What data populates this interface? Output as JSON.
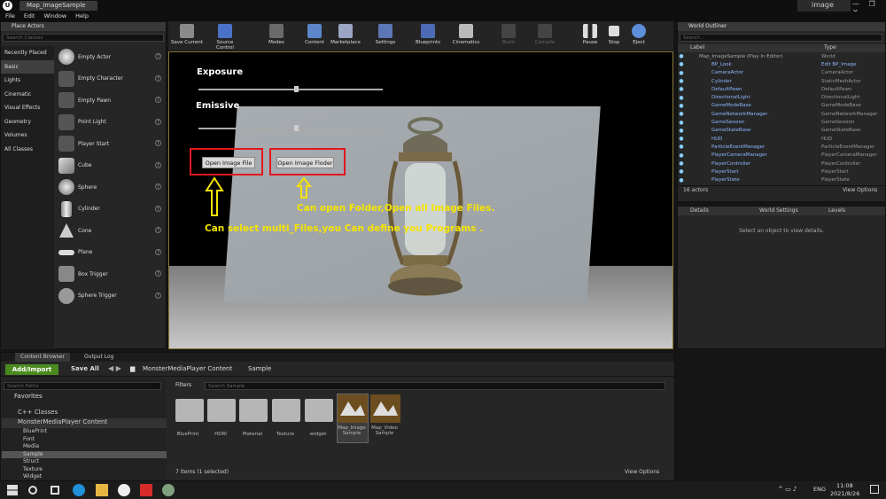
{
  "window": {
    "tab": "Map_ImageSample",
    "project": "image",
    "controls": "— ❐ ✕"
  },
  "menu": [
    "File",
    "Edit",
    "Window",
    "Help"
  ],
  "place_actors": {
    "tab": "Place Actors",
    "search_placeholder": "Search Classes",
    "categories": [
      "Recently Placed",
      "Basic",
      "Lights",
      "Cinematic",
      "Visual Effects",
      "Geometry",
      "Volumes",
      "All Classes"
    ],
    "selected": "Basic",
    "actors": [
      "Empty Actor",
      "Empty Character",
      "Empty Pawn",
      "Point Light",
      "Player Start",
      "Cube",
      "Sphere",
      "Cylinder",
      "Cone",
      "Plane",
      "Box Trigger",
      "Sphere Trigger"
    ],
    "help": "?"
  },
  "toolbar": [
    {
      "label": "Save Current"
    },
    {
      "label": "Source Control"
    },
    {
      "label": "Modes"
    },
    {
      "label": "Content"
    },
    {
      "label": "Marketplace"
    },
    {
      "label": "Settings"
    },
    {
      "label": "Blueprints"
    },
    {
      "label": "Cinematics"
    },
    {
      "label": "Build"
    },
    {
      "label": "Compile"
    },
    {
      "label": "Pause"
    },
    {
      "label": "Stop"
    },
    {
      "label": "Eject"
    }
  ],
  "viewport": {
    "exposure": "Exposure",
    "emissive": "Emissive",
    "exposure_level": 0.52,
    "emissive_level": 0.52,
    "open_file": "Open Image File",
    "open_folder": "Open Image Floder",
    "note_folder": "Can open Folder,Open all Image Files.",
    "note_files": "Can select multi_Files,you Can define you Programs ."
  },
  "outliner": {
    "tab": "World Outliner",
    "search_placeholder": "Search...",
    "col_label": "Label",
    "col_type": "Type",
    "rows": [
      [
        "Map_ImageSample (Play In Editor)",
        "World"
      ],
      [
        "BP_Look",
        "Edit BP_Image"
      ],
      [
        "CameraActor",
        "CameraActor"
      ],
      [
        "Cylinder",
        "StaticMeshActor"
      ],
      [
        "DefaultPawn",
        "DefaultPawn"
      ],
      [
        "DirectionalLight",
        "DirectionalLight"
      ],
      [
        "GameModeBase",
        "GameModeBase"
      ],
      [
        "GameNetworkManager",
        "GameNetworkManager"
      ],
      [
        "GameSession",
        "GameSession"
      ],
      [
        "GameStateBase",
        "GameStateBase"
      ],
      [
        "HUD",
        "HUD"
      ],
      [
        "ParticleEventManager",
        "ParticleEventManager"
      ],
      [
        "PlayerCameraManager",
        "PlayerCameraManager"
      ],
      [
        "PlayerController",
        "PlayerController"
      ],
      [
        "PlayerStart",
        "PlayerStart"
      ],
      [
        "PlayerState",
        "PlayerState"
      ]
    ],
    "count": "16 actors",
    "view_options": "View Options"
  },
  "details": {
    "tab_details": "Details",
    "tab_world": "World Settings",
    "tab_levels": "Levels",
    "empty": "Select an object to view details."
  },
  "content_browser": {
    "tab": "Content Browser",
    "tab_output": "Output Log",
    "add": "Add/Import",
    "save_all": "Save All",
    "path": [
      "MonsterMediaPlayer Content",
      "Sample"
    ],
    "search_paths": "Search Paths",
    "favorites": "Favorites",
    "tree": [
      "C++ Classes",
      "MonsterMediaPlayer Content",
      "BluePrint",
      "Font",
      "Media",
      "Sample",
      "Struct",
      "Texture",
      "Widget"
    ],
    "filters": "Filters",
    "search_placeholder": "Search Sample",
    "items": [
      "BluePrint",
      "HDRI",
      "Material",
      "Texture",
      "widget",
      "Map_Image Sample",
      "Map_Video Sample"
    ],
    "status": "7 items (1 selected)",
    "view_options": "View Options"
  },
  "taskbar": {
    "lang": "ENG",
    "time": "11:08",
    "date": "2021/8/26"
  },
  "colors": {
    "accent": "#e0171f",
    "annotation": "#f5e400",
    "add_button": "#4b8a1f"
  }
}
